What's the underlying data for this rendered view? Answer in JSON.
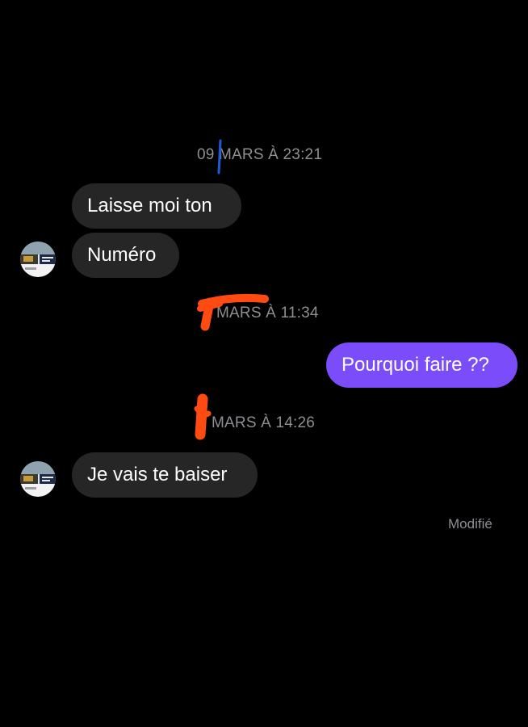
{
  "conversation": {
    "timestamps": {
      "first": "09 MARS À 23:21",
      "second": "MARS À 11:34",
      "third": "MARS À 14:26"
    },
    "messages": [
      {
        "text": "Laisse moi ton"
      },
      {
        "text": "Numéro"
      },
      {
        "text": "Pourquoi faire ??"
      },
      {
        "text": "Je vais te baiser"
      }
    ],
    "edited_label": "Modifié"
  },
  "colors": {
    "background": "#000000",
    "incoming_bubble": "#262626",
    "outgoing_bubble": "#7b4dfa",
    "timestamp_text": "#8e8e93",
    "redaction_orange": "#ff4a12",
    "redaction_blue": "#1f5bd8"
  },
  "icons": {
    "avatar": "contact-avatar"
  }
}
